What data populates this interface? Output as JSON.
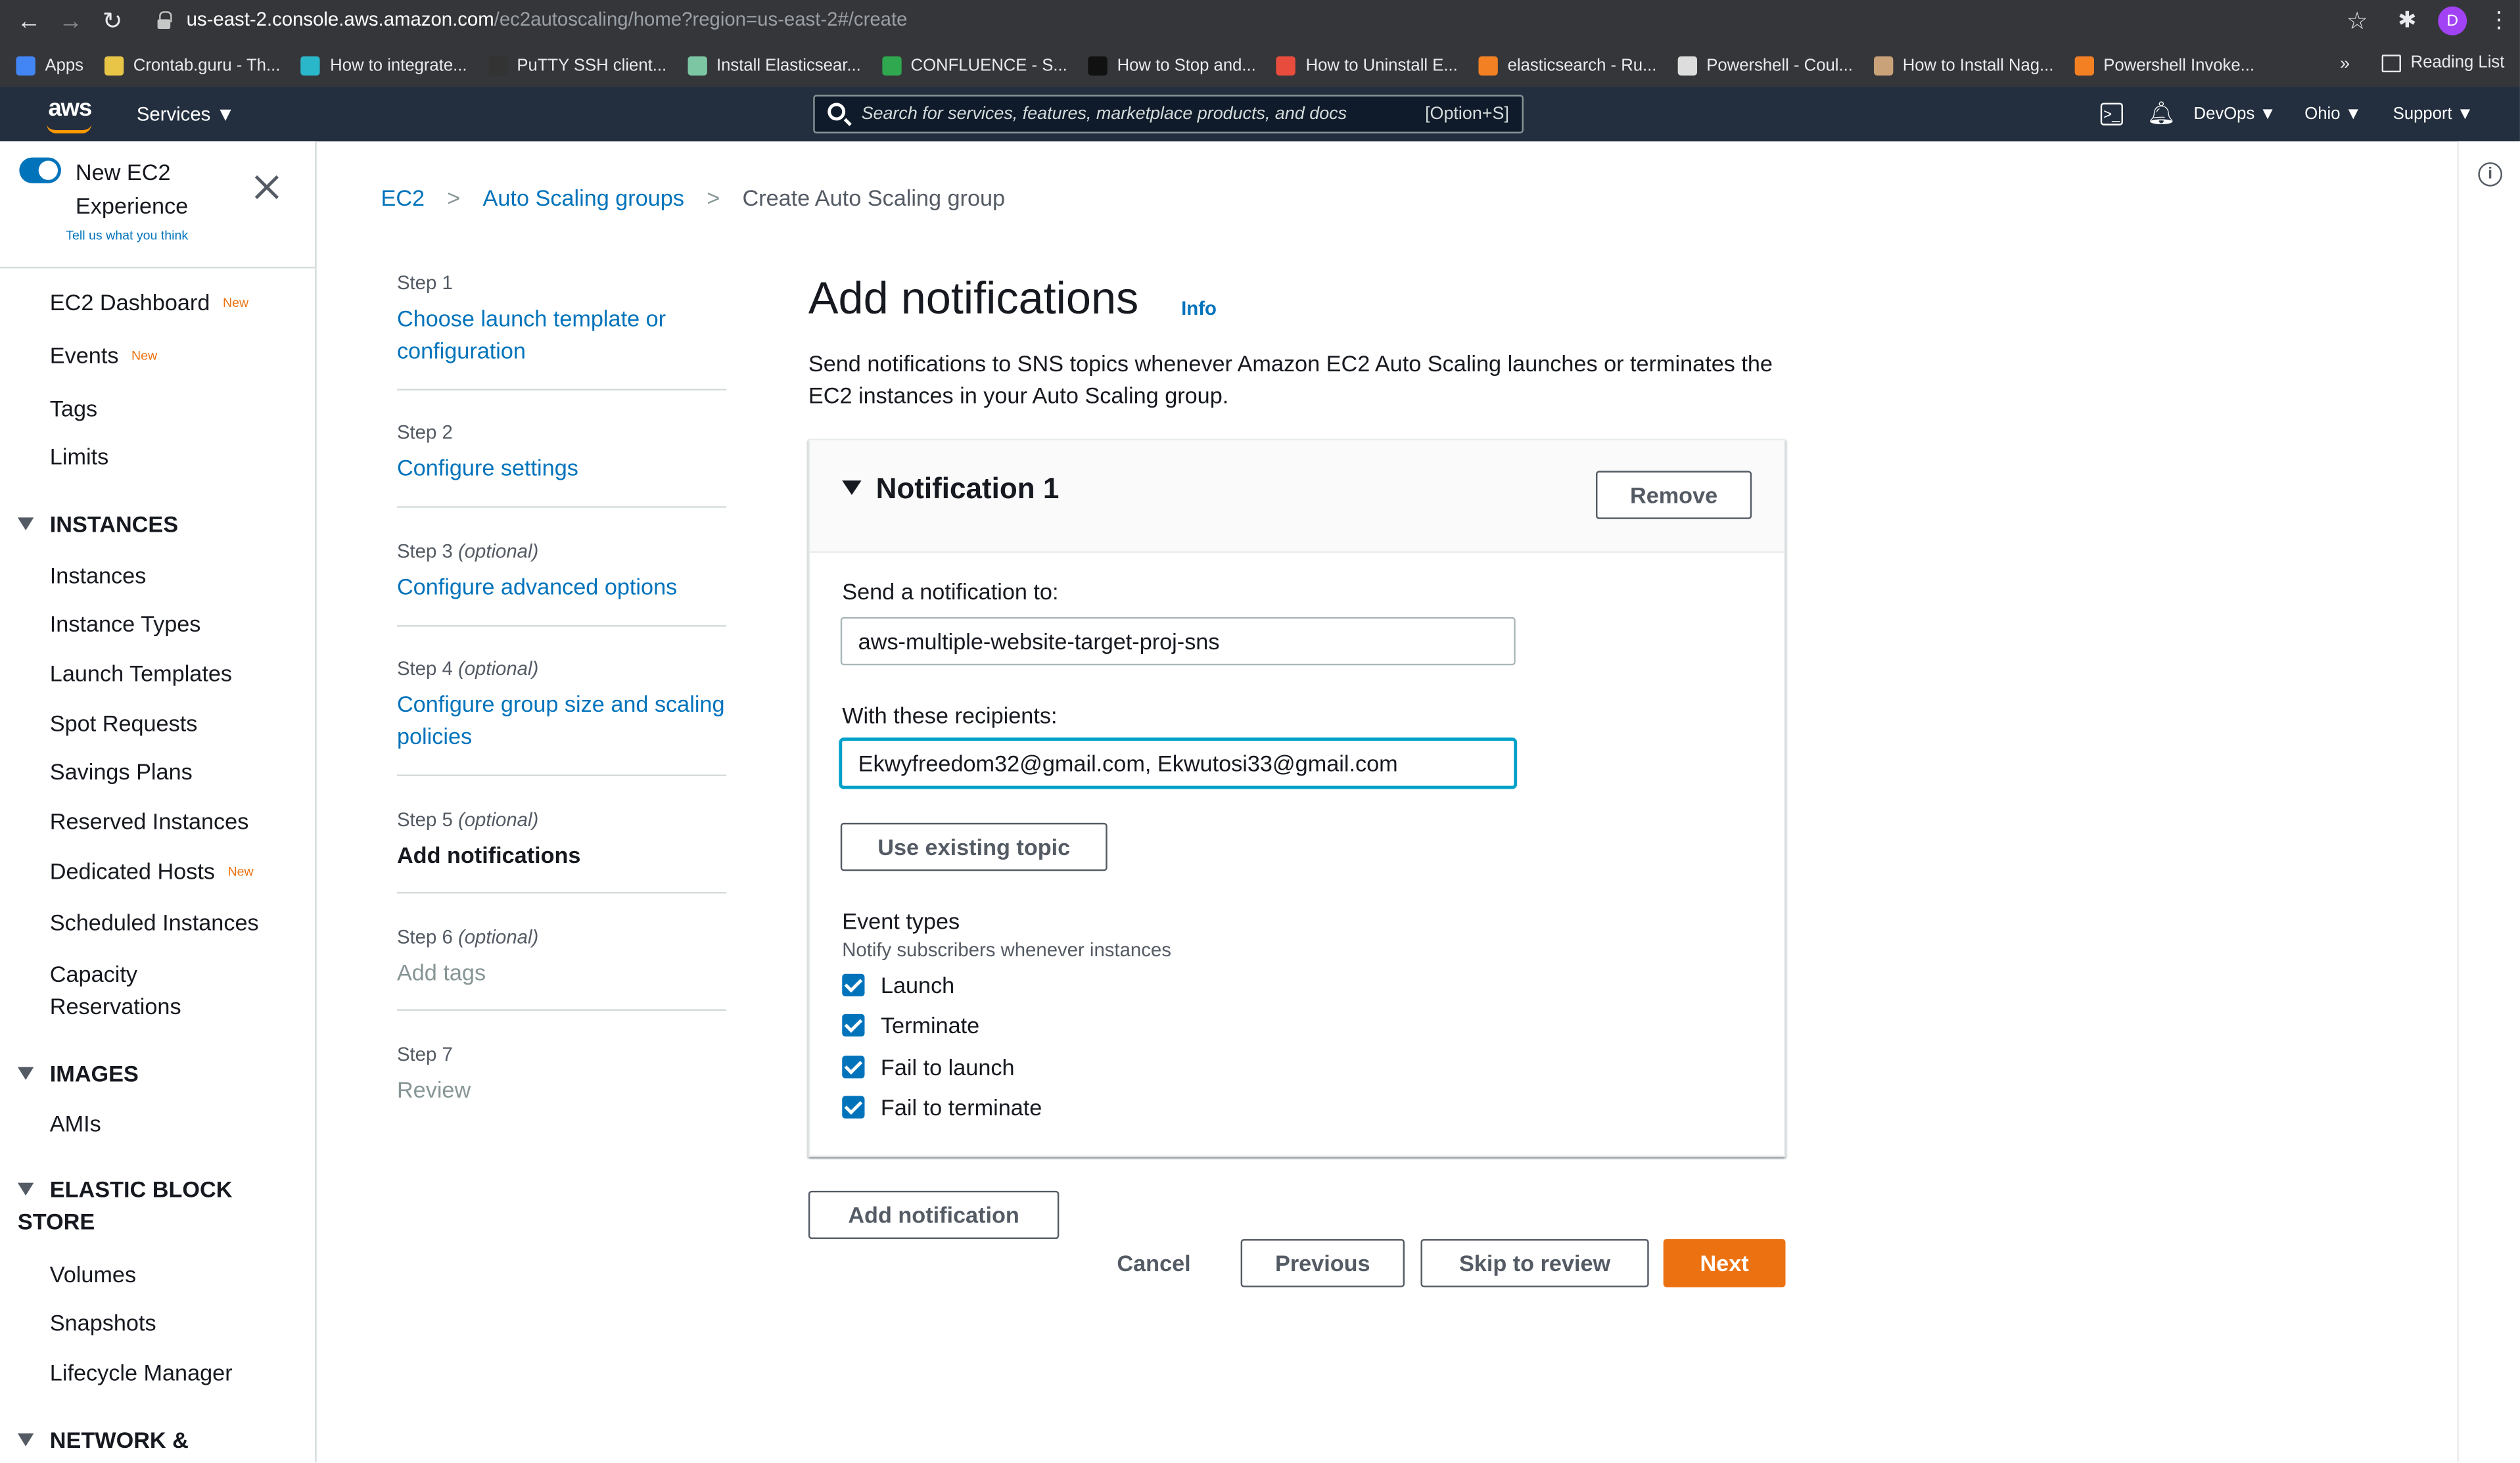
{
  "browser": {
    "url_host": "us-east-2.console.aws.amazon.com",
    "url_path": "/ec2autoscaling/home?region=us-east-2#/create",
    "profile_initial": "D",
    "bookmarks": [
      {
        "label": "Apps",
        "color": "#4285f4"
      },
      {
        "label": "Crontab.guru - Th...",
        "color": "#e8c547"
      },
      {
        "label": "How to integrate...",
        "color": "#2ab7ca"
      },
      {
        "label": "PuTTY SSH client...",
        "color": "#333333"
      },
      {
        "label": "Install Elasticsear...",
        "color": "#7cc6a4"
      },
      {
        "label": "CONFLUENCE - S...",
        "color": "#2fa84f"
      },
      {
        "label": "How to Stop and...",
        "color": "#111111"
      },
      {
        "label": "How to Uninstall E...",
        "color": "#e84c3d"
      },
      {
        "label": "elasticsearch - Ru...",
        "color": "#f48024"
      },
      {
        "label": "Powershell - Coul...",
        "color": "#dddddd"
      },
      {
        "label": "How to Install Nag...",
        "color": "#c9a27a"
      },
      {
        "label": "Powershell Invoke...",
        "color": "#f48024"
      }
    ],
    "more": "»",
    "reading_list": "Reading List"
  },
  "header": {
    "logo": "aws",
    "services": "Services ▼",
    "search_placeholder": "Search for services, features, marketplace products, and docs",
    "search_shortcut": "[Option+S]",
    "account": "DevOps ▼",
    "region": "Ohio ▼",
    "support": "Support ▼"
  },
  "sidebar": {
    "new_experience": "New EC2 Experience",
    "feedback": "Tell us what you think",
    "new_badge": "New",
    "items": {
      "dashboard": "EC2 Dashboard",
      "events": "Events",
      "tags": "Tags",
      "limits": "Limits",
      "instances_section": "INSTANCES",
      "instances": "Instances",
      "instance_types": "Instance Types",
      "launch_templates": "Launch Templates",
      "spot_requests": "Spot Requests",
      "savings_plans": "Savings Plans",
      "reserved_instances": "Reserved Instances",
      "dedicated_hosts": "Dedicated Hosts",
      "scheduled_instances": "Scheduled Instances",
      "capacity_reservations": "Capacity Reservations",
      "images_section": "IMAGES",
      "amis": "AMIs",
      "ebs_section": "ELASTIC BLOCK STORE",
      "volumes": "Volumes",
      "snapshots": "Snapshots",
      "lifecycle_manager": "Lifecycle Manager",
      "network_section": "NETWORK &"
    }
  },
  "breadcrumb": {
    "ec2": "EC2",
    "asg": "Auto Scaling groups",
    "current": "Create Auto Scaling group"
  },
  "steps": [
    {
      "num": "Step 1",
      "optional": "",
      "label": "Choose launch template or configuration"
    },
    {
      "num": "Step 2",
      "optional": "",
      "label": "Configure settings"
    },
    {
      "num": "Step 3",
      "optional": "(optional)",
      "label": "Configure advanced options"
    },
    {
      "num": "Step 4",
      "optional": "(optional)",
      "label": "Configure group size and scaling policies"
    },
    {
      "num": "Step 5",
      "optional": "(optional)",
      "label": "Add notifications"
    },
    {
      "num": "Step 6",
      "optional": "(optional)",
      "label": "Add tags"
    },
    {
      "num": "Step 7",
      "optional": "",
      "label": "Review"
    }
  ],
  "main": {
    "title": "Add notifications",
    "info": "Info",
    "description": "Send notifications to SNS topics whenever Amazon EC2 Auto Scaling launches or terminates the EC2 instances in your Auto Scaling group.",
    "notification": {
      "title": "Notification 1",
      "remove": "Remove",
      "send_to_label": "Send a notification to:",
      "send_to_value": "aws-multiple-website-target-proj-sns",
      "recipients_label": "With these recipients:",
      "recipients_value": "Ekwyfreedom32@gmail.com, Ekwutosi33@gmail.com",
      "use_existing": "Use existing topic",
      "event_types_label": "Event types",
      "event_types_sub": "Notify subscribers whenever instances",
      "events": [
        {
          "label": "Launch",
          "checked": true
        },
        {
          "label": "Terminate",
          "checked": true
        },
        {
          "label": "Fail to launch",
          "checked": true
        },
        {
          "label": "Fail to terminate",
          "checked": true
        }
      ]
    },
    "add_notification": "Add notification",
    "cancel": "Cancel",
    "previous": "Previous",
    "skip": "Skip to review",
    "next": "Next"
  }
}
